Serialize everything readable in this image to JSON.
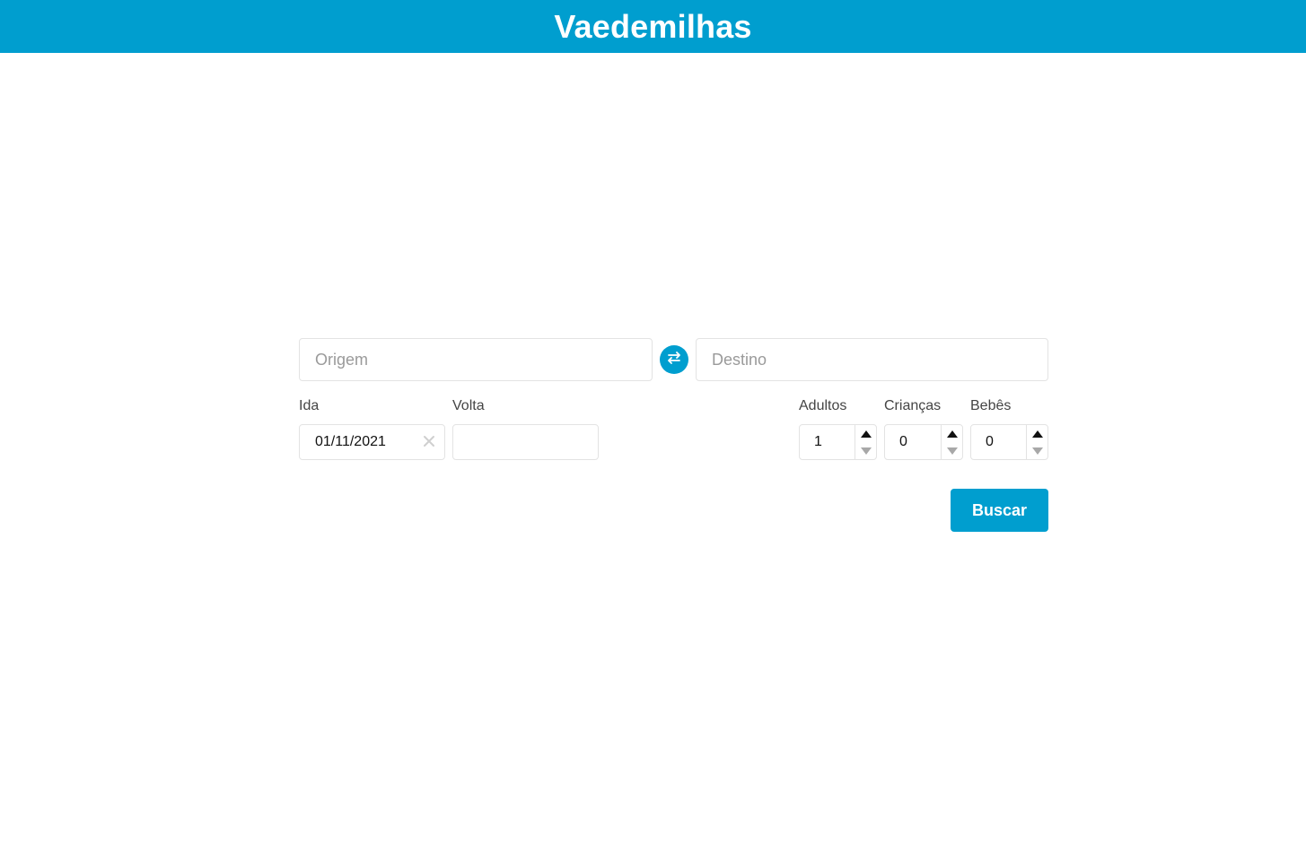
{
  "app": {
    "title": "Vaedemilhas"
  },
  "search": {
    "origin_placeholder": "Origem",
    "destination_placeholder": "Destino",
    "swap_icon": "swap-arrows-icon",
    "depart_label": "Ida",
    "depart_value": "01/11/2021",
    "return_label": "Volta",
    "return_value": "",
    "adults_label": "Adultos",
    "adults_value": "1",
    "children_label": "Crianças",
    "children_value": "0",
    "infants_label": "Bebês",
    "infants_value": "0",
    "submit_label": "Buscar"
  },
  "colors": {
    "brand": "#009ecf",
    "border": "#e3e3e3",
    "placeholder": "#9a9a9a"
  }
}
